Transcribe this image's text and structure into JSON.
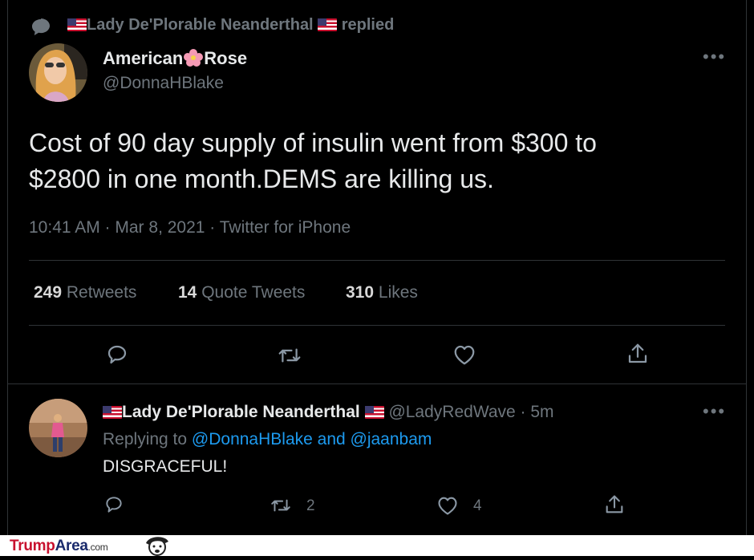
{
  "context": {
    "prefix": "Lady De'Plorable Neanderthal",
    "suffix": "replied"
  },
  "main_tweet": {
    "display_name_a": "American",
    "display_name_b": "Rose",
    "handle": "@DonnaHBlake",
    "text_line1": "Cost of 90 day supply of insulin went from $300 to",
    "text_line2": "$2800 in one month.DEMS are killing us.",
    "meta": "10:41 AM · Mar 8, 2021 · Twitter for iPhone",
    "stats": [
      {
        "count": "249",
        "label": "Retweets"
      },
      {
        "count": "14",
        "label": "Quote Tweets"
      },
      {
        "count": "310",
        "label": "Likes"
      }
    ]
  },
  "reply": {
    "display_name": "Lady De'Plorable Neanderthal",
    "handle_time": "@LadyRedWave · 5m",
    "replying_prefix": "Replying to",
    "replying_users": "@DonnaHBlake and @jaanbam",
    "text": "DISGRACEFUL!",
    "retweet_count": "2",
    "like_count": "4"
  },
  "watermark": {
    "brand_a": "Trump",
    "brand_b": "Area",
    "brand_c": ".com"
  },
  "colors": {
    "background": "#000000",
    "text": "#d9d9d9",
    "muted": "#6e767d",
    "link": "#1d9bf0",
    "brand_red": "#c8102e"
  },
  "icons": [
    "speech-bubble-icon",
    "flag-icon",
    "flower-icon",
    "more-icon",
    "reply-icon",
    "retweet-icon",
    "like-icon",
    "share-icon"
  ]
}
